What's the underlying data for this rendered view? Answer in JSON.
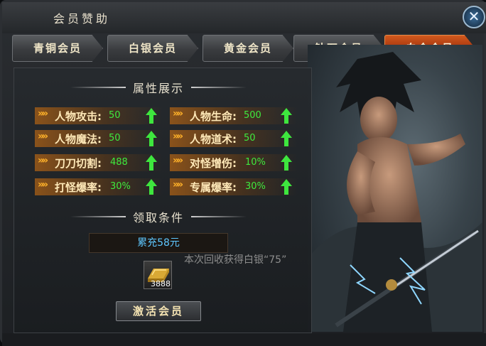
{
  "window": {
    "title": "会员赞助",
    "close_label": "✕"
  },
  "tabs": [
    {
      "label": "青铜会员",
      "active": false
    },
    {
      "label": "白银会员",
      "active": false
    },
    {
      "label": "黄金会员",
      "active": false
    },
    {
      "label": "钻石会员",
      "active": false
    },
    {
      "label": "白金会员",
      "active": true
    }
  ],
  "attributes": {
    "heading": "属性展示",
    "items": [
      {
        "name": "人物攻击:",
        "value": "50"
      },
      {
        "name": "人物生命:",
        "value": "500"
      },
      {
        "name": "人物魔法:",
        "value": "50"
      },
      {
        "name": "人物道术:",
        "value": "50"
      },
      {
        "name": "刀刀切割:",
        "value": "488"
      },
      {
        "name": "对怪增伤:",
        "value": "10%"
      },
      {
        "name": "打怪爆率:",
        "value": "30%"
      },
      {
        "name": "专属爆率:",
        "value": "30%"
      }
    ]
  },
  "conditions": {
    "heading": "领取条件",
    "requirement": "累充58元",
    "tooltip": "本次回收获得白银“75”",
    "reward_quantity": "3888"
  },
  "activate_button": "激活会员",
  "colors": {
    "accent_orange": "#c9501a",
    "value_green": "#3eea3e",
    "cyan_text": "#5ec7ff",
    "attr_text": "#ffe9b8"
  }
}
